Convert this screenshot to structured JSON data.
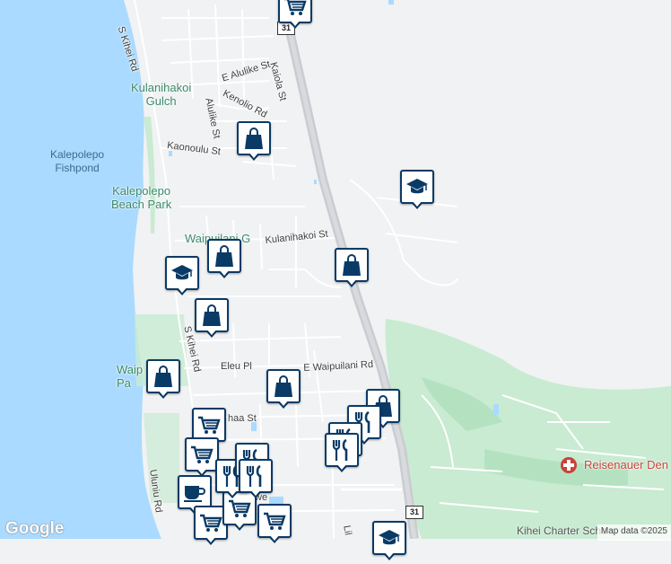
{
  "map": {
    "place_labels": {
      "kulanihakoi_gulch": "Kulanihakoi\nGulch",
      "waipuilani_gulch": "Waipuilani G",
      "waipuilani_park": "Waip\nPa",
      "kalepolepo_beach_park": "Kalepolepo\nBeach Park"
    },
    "water_labels": {
      "kalepolepo_fishpond": "Kalepolepo\nFishpond"
    },
    "road_labels": {
      "s_kihei_rd_north": "S Kihei Rd",
      "s_kihei_rd_south": "S Kihei Rd",
      "e_alulike_st": "E Alulike St",
      "kaiola_st": "Kaiola St",
      "kenolio_rd": "Kenolio Rd",
      "alulike_st": "Alulike St",
      "kaonoulu_st": "Kaonoulu St",
      "kulanihakoi_st": "Kulanihakoi St",
      "eleu_pl": "Eleu Pl",
      "e_waipuilani_rd": "E Waipuilani Rd",
      "haa_st": "haa St",
      "uluniu_rd": "Uluniu Rd",
      "lil": "Lil",
      "we": "we"
    },
    "route_shields": [
      "31",
      "31"
    ],
    "poi_labels": {
      "reisenauer": "Reisenauer Den",
      "kihei_charter": "Kihei Charter Scho"
    },
    "markers": [
      {
        "icon": "cart-icon"
      },
      {
        "icon": "shopping-bag-icon"
      },
      {
        "icon": "school-icon"
      },
      {
        "icon": "shopping-bag-icon"
      },
      {
        "icon": "shopping-bag-icon"
      },
      {
        "icon": "school-icon"
      },
      {
        "icon": "shopping-bag-icon"
      },
      {
        "icon": "shopping-bag-icon"
      },
      {
        "icon": "shopping-bag-icon"
      },
      {
        "icon": "shopping-bag-icon"
      },
      {
        "icon": "cart-icon"
      },
      {
        "icon": "cart-icon"
      },
      {
        "icon": "restaurant-icon"
      },
      {
        "icon": "restaurant-icon"
      },
      {
        "icon": "restaurant-icon"
      },
      {
        "icon": "coffee-icon"
      },
      {
        "icon": "cart-icon"
      },
      {
        "icon": "cart-icon"
      },
      {
        "icon": "cart-icon"
      },
      {
        "icon": "restaurant-icon"
      },
      {
        "icon": "restaurant-icon"
      },
      {
        "icon": "restaurant-icon"
      },
      {
        "icon": "school-icon"
      }
    ],
    "google_logo": "Google",
    "attribution": "Map data ©2025"
  },
  "colors": {
    "water": "#aadaff",
    "land": "#f1f2f3",
    "park": "#c8ebd2",
    "highway": "#c9ccd1",
    "marker_border": "#0a3a66",
    "poi_red": "#c7443a"
  }
}
